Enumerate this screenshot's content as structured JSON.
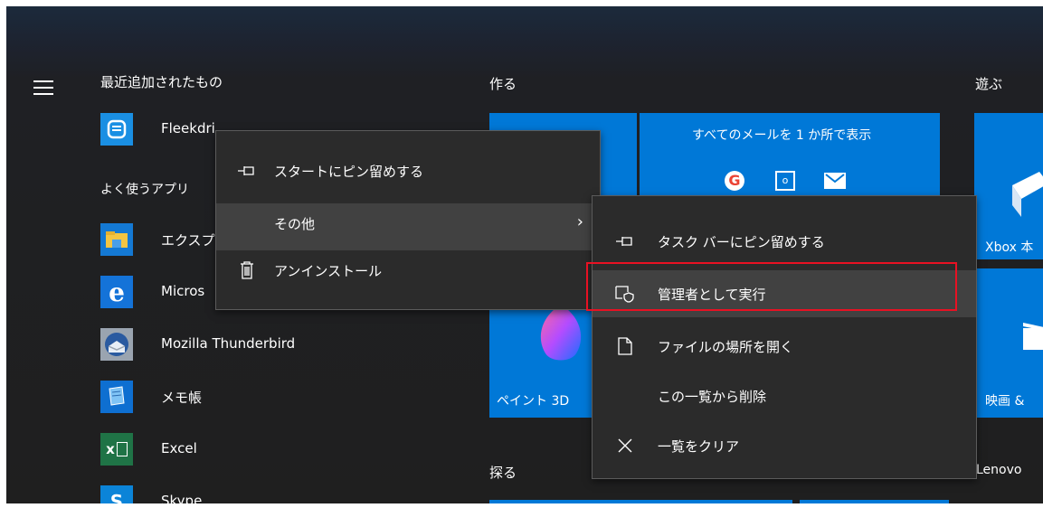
{
  "left_column": {
    "recent_header": "最近追加されたもの",
    "frequent_header": "よく使うアプリ",
    "apps": [
      {
        "name": "Fleekdri",
        "icon": "fleekdrive-icon",
        "color": "#1a8fe3"
      },
      {
        "name": "エクスプ",
        "icon": "file-explorer-icon",
        "color": "#1479d4"
      },
      {
        "name": "Micros",
        "icon": "edge-icon",
        "color": "#1473d8"
      },
      {
        "name": "Mozilla Thunderbird",
        "icon": "thunderbird-icon",
        "color": "#2f2f2f"
      },
      {
        "name": "メモ帳",
        "icon": "notepad-icon",
        "color": "#0e6fd1"
      },
      {
        "name": "Excel",
        "icon": "excel-icon",
        "color": "#1f7346"
      },
      {
        "name": "Skype",
        "icon": "skype-icon",
        "color": "#0b84d8"
      }
    ]
  },
  "groups": {
    "create": "作る",
    "play": "遊ぶ",
    "explore": "探る",
    "lenovo": "Lenovo"
  },
  "tiles": {
    "mail_header": "すべてのメールを 1 か所で表示",
    "paint3d": "ペイント 3D",
    "xbox": "Xbox 本",
    "movies": "映画 &"
  },
  "context_menu": {
    "pin_start": "スタートにピン留めする",
    "more": "その他",
    "uninstall": "アンインストール"
  },
  "submenu": {
    "pin_taskbar": "タスク バーにピン留めする",
    "run_as_admin": "管理者として実行",
    "open_location": "ファイルの場所を開く",
    "remove_from_list": "この一覧から削除",
    "clear_list": "一覧をクリア"
  },
  "colors": {
    "tile_blue": "#0078d7",
    "highlight_red": "#e81123"
  }
}
